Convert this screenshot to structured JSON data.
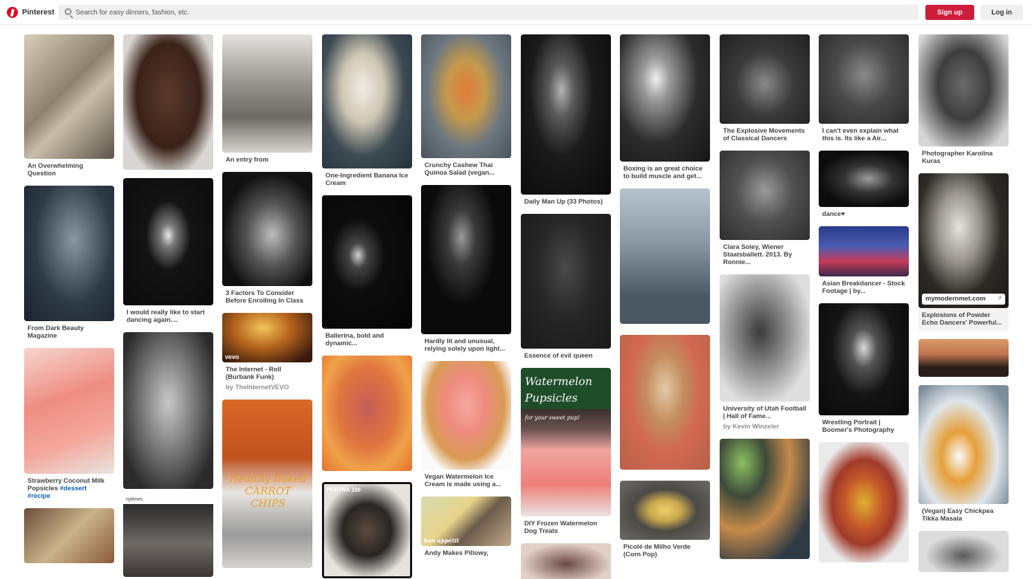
{
  "header": {
    "brand": "Pinterest",
    "search_placeholder": "Search for easy dinners, fashion, etc.",
    "signup_label": "Sign up",
    "login_label": "Log in"
  },
  "colors": {
    "brand_red": "#e60023",
    "signup_red": "#cd1d3a",
    "search_bg": "#efefef"
  },
  "columns": [
    {
      "pins": [
        {
          "caption": "An Overwhelming Question"
        },
        {
          "caption": "From Dark Beauty Magazine"
        },
        {
          "caption": "Strawberry Coconut Milk Popsicles",
          "hashtags": "#dessert #recipe"
        },
        {
          "caption": ""
        }
      ]
    },
    {
      "pins": [
        {
          "caption": ""
        },
        {
          "caption": "I would really like to start dancing again...."
        },
        {
          "caption": ""
        },
        {
          "caption": "",
          "overlay": "nytimes"
        }
      ]
    },
    {
      "pins": [
        {
          "caption": "An entry from"
        },
        {
          "caption": "3 Factors To Consider Before Enrolling In Class"
        },
        {
          "caption": "The Internet - Roll (Burbank Funk)",
          "byline": "by TheInternetVEVO",
          "overlay": "vevo"
        },
        {
          "caption": "",
          "overlay": "Healthy Baked CARROT CHIPS"
        }
      ]
    },
    {
      "pins": [
        {
          "caption": "One-Ingredient Banana Ice Cream"
        },
        {
          "caption": "Ballerina, bold and dynamic..."
        },
        {
          "caption": ""
        },
        {
          "caption": "",
          "overlay": "PORTRA 160"
        }
      ]
    },
    {
      "pins": [
        {
          "caption": "Crunchy Cashew Thai Quinoa Salad (vegan..."
        },
        {
          "caption": "Hardly lit and unusual, relying solely upon light..."
        },
        {
          "caption": "Vegan Watermelon Ice Cream is made using a..."
        },
        {
          "caption": "Andy Makes Pillowy,",
          "overlay": "bon appétit"
        }
      ]
    },
    {
      "pins": [
        {
          "caption": "Daily Man Up (33 Photos)"
        },
        {
          "caption": "Essence of evil queen"
        },
        {
          "caption": "DIY Frozen Watermelon Dog Treats",
          "overlay_title": "Watermelon Pupsicles",
          "overlay_sub": "for your sweet pup!"
        },
        {
          "caption": ""
        }
      ]
    },
    {
      "pins": [
        {
          "caption": "Boxing is an great choice to build muscle and get..."
        },
        {
          "caption": ""
        },
        {
          "caption": ""
        },
        {
          "caption": "Picolé de Milho Verde (Corn Pop)"
        }
      ]
    },
    {
      "pins": [
        {
          "caption": "The Explosive Movements of Classical Dancers"
        },
        {
          "caption": "Clara Soley, Wiener Staatsballett. 2013. By Ronnie..."
        },
        {
          "caption": "University of Utah Football | Hall of Fame...",
          "byline": "by Kevin Winzeler"
        },
        {
          "caption": ""
        }
      ]
    },
    {
      "pins": [
        {
          "caption": "I can't even explain what this is. Its like a Air..."
        },
        {
          "caption": "dance♥"
        },
        {
          "caption": "Asian Breakdancer - Stock Footage | by..."
        },
        {
          "caption": "Wrestling Portrait | Boomer's Photography"
        },
        {
          "caption": ""
        }
      ]
    },
    {
      "pins": [
        {
          "caption": "Photographer Karolina Kuras"
        },
        {
          "caption": "Explosions of Powder Echo Dancers' Powerful...",
          "badge": "mymodernmet.com"
        },
        {
          "caption": ""
        },
        {
          "caption": "(Vegan) Easy Chickpea Tikka Masala"
        },
        {
          "caption": ""
        }
      ]
    }
  ]
}
